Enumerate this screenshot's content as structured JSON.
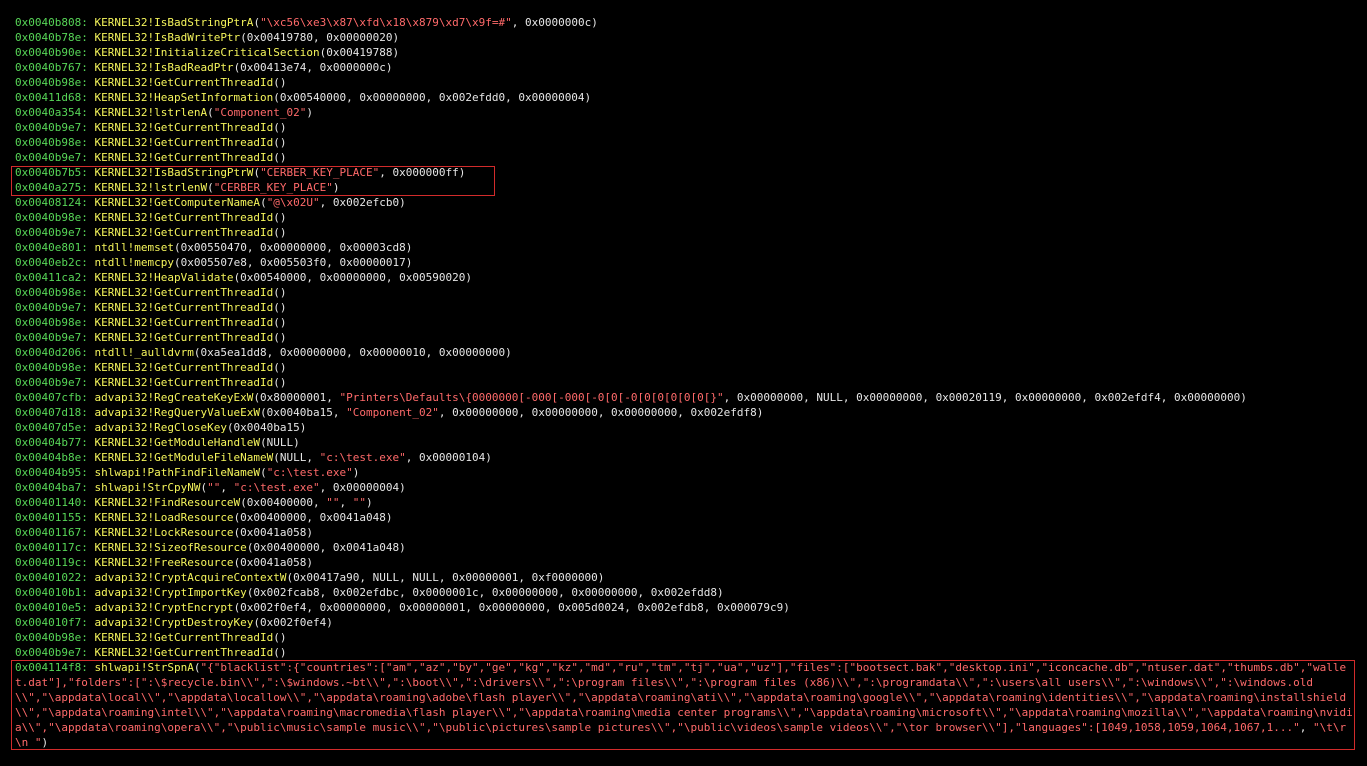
{
  "lines": [
    {
      "addr": "0x0040b808:",
      "fn": "KERNEL32!IsBadStringPtrA",
      "args": [
        [
          "p",
          "("
        ],
        [
          "s",
          "\"\\xc56\\xe3\\x87\\xfd\\x18\\x879\\xd7\\x9f=#\""
        ],
        [
          "p",
          ", 0x0000000c)"
        ]
      ]
    },
    {
      "addr": "0x0040b78e:",
      "fn": "KERNEL32!IsBadWritePtr",
      "args": [
        [
          "p",
          "(0x00419780, 0x00000020)"
        ]
      ]
    },
    {
      "addr": "0x0040b90e:",
      "fn": "KERNEL32!InitializeCriticalSection",
      "args": [
        [
          "p",
          "(0x00419788)"
        ]
      ]
    },
    {
      "addr": "0x0040b767:",
      "fn": "KERNEL32!IsBadReadPtr",
      "args": [
        [
          "p",
          "(0x00413e74, 0x0000000c)"
        ]
      ]
    },
    {
      "addr": "0x0040b98e:",
      "fn": "KERNEL32!GetCurrentThreadId",
      "args": [
        [
          "p",
          "()"
        ]
      ]
    },
    {
      "addr": "0x00411d68:",
      "fn": "KERNEL32!HeapSetInformation",
      "args": [
        [
          "p",
          "(0x00540000, 0x00000000, 0x002efdd0, 0x00000004)"
        ]
      ]
    },
    {
      "addr": "0x0040a354:",
      "fn": "KERNEL32!lstrlenA",
      "args": [
        [
          "p",
          "("
        ],
        [
          "s",
          "\"Component_02\""
        ],
        [
          "p",
          ")"
        ]
      ]
    },
    {
      "addr": "0x0040b9e7:",
      "fn": "KERNEL32!GetCurrentThreadId",
      "args": [
        [
          "p",
          "()"
        ]
      ]
    },
    {
      "addr": "0x0040b98e:",
      "fn": "KERNEL32!GetCurrentThreadId",
      "args": [
        [
          "p",
          "()"
        ]
      ]
    },
    {
      "addr": "0x0040b9e7:",
      "fn": "KERNEL32!GetCurrentThreadId",
      "args": [
        [
          "p",
          "()"
        ]
      ]
    },
    {
      "addr": "0x0040b7b5:",
      "fn": "KERNEL32!IsBadStringPtrW",
      "args": [
        [
          "p",
          "("
        ],
        [
          "s",
          "\"CERBER_KEY_PLACE\""
        ],
        [
          "p",
          ", 0x000000ff)"
        ]
      ]
    },
    {
      "addr": "0x0040a275:",
      "fn": "KERNEL32!lstrlenW",
      "args": [
        [
          "p",
          "("
        ],
        [
          "s",
          "\"CERBER_KEY_PLACE\""
        ],
        [
          "p",
          ")"
        ]
      ]
    },
    {
      "addr": "0x00408124:",
      "fn": "KERNEL32!GetComputerNameA",
      "args": [
        [
          "p",
          "("
        ],
        [
          "s",
          "\"@\\x02U\""
        ],
        [
          "p",
          ", 0x002efcb0)"
        ]
      ]
    },
    {
      "addr": "0x0040b98e:",
      "fn": "KERNEL32!GetCurrentThreadId",
      "args": [
        [
          "p",
          "()"
        ]
      ]
    },
    {
      "addr": "0x0040b9e7:",
      "fn": "KERNEL32!GetCurrentThreadId",
      "args": [
        [
          "p",
          "()"
        ]
      ]
    },
    {
      "addr": "0x0040e801:",
      "fn": "ntdll!memset",
      "args": [
        [
          "p",
          "(0x00550470, 0x00000000, 0x00003cd8)"
        ]
      ]
    },
    {
      "addr": "0x0040eb2c:",
      "fn": "ntdll!memcpy",
      "args": [
        [
          "p",
          "(0x005507e8, 0x005503f0, 0x00000017)"
        ]
      ]
    },
    {
      "addr": "0x00411ca2:",
      "fn": "KERNEL32!HeapValidate",
      "args": [
        [
          "p",
          "(0x00540000, 0x00000000, 0x00590020)"
        ]
      ]
    },
    {
      "addr": "0x0040b98e:",
      "fn": "KERNEL32!GetCurrentThreadId",
      "args": [
        [
          "p",
          "()"
        ]
      ]
    },
    {
      "addr": "0x0040b9e7:",
      "fn": "KERNEL32!GetCurrentThreadId",
      "args": [
        [
          "p",
          "()"
        ]
      ]
    },
    {
      "addr": "0x0040b98e:",
      "fn": "KERNEL32!GetCurrentThreadId",
      "args": [
        [
          "p",
          "()"
        ]
      ]
    },
    {
      "addr": "0x0040b9e7:",
      "fn": "KERNEL32!GetCurrentThreadId",
      "args": [
        [
          "p",
          "()"
        ]
      ]
    },
    {
      "addr": "0x0040d206:",
      "fn": "ntdll!_aulldvrm",
      "args": [
        [
          "p",
          "(0xa5ea1dd8, 0x00000000, 0x00000010, 0x00000000)"
        ]
      ]
    },
    {
      "addr": "0x0040b98e:",
      "fn": "KERNEL32!GetCurrentThreadId",
      "args": [
        [
          "p",
          "()"
        ]
      ]
    },
    {
      "addr": "0x0040b9e7:",
      "fn": "KERNEL32!GetCurrentThreadId",
      "args": [
        [
          "p",
          "()"
        ]
      ]
    },
    {
      "addr": "0x00407cfb:",
      "fn": "advapi32!RegCreateKeyExW",
      "args": [
        [
          "p",
          "(0x80000001, "
        ],
        [
          "s",
          "\"Printers\\Defaults\\{0000000[-000[-000[-0[0[-0[0[0[0[0[0[}\""
        ],
        [
          "p",
          ", 0x00000000, NULL, 0x00000000, 0x00020119, 0x00000000, 0x002efdf4, 0x00000000)"
        ]
      ]
    },
    {
      "addr": "0x00407d18:",
      "fn": "advapi32!RegQueryValueExW",
      "args": [
        [
          "p",
          "(0x0040ba15, "
        ],
        [
          "s",
          "\"Component_02\""
        ],
        [
          "p",
          ", 0x00000000, 0x00000000, 0x00000000, 0x002efdf8)"
        ]
      ]
    },
    {
      "addr": "0x00407d5e:",
      "fn": "advapi32!RegCloseKey",
      "args": [
        [
          "p",
          "(0x0040ba15)"
        ]
      ]
    },
    {
      "addr": "0x00404b77:",
      "fn": "KERNEL32!GetModuleHandleW",
      "args": [
        [
          "p",
          "(NULL)"
        ]
      ]
    },
    {
      "addr": "0x00404b8e:",
      "fn": "KERNEL32!GetModuleFileNameW",
      "args": [
        [
          "p",
          "(NULL, "
        ],
        [
          "s",
          "\"c:\\test.exe\""
        ],
        [
          "p",
          ", 0x00000104)"
        ]
      ]
    },
    {
      "addr": "0x00404b95:",
      "fn": "shlwapi!PathFindFileNameW",
      "args": [
        [
          "p",
          "("
        ],
        [
          "s",
          "\"c:\\test.exe\""
        ],
        [
          "p",
          ")"
        ]
      ]
    },
    {
      "addr": "0x00404ba7:",
      "fn": "shlwapi!StrCpyNW",
      "args": [
        [
          "p",
          "("
        ],
        [
          "s",
          "\"\""
        ],
        [
          "p",
          ", "
        ],
        [
          "s",
          "\"c:\\test.exe\""
        ],
        [
          "p",
          ", 0x00000004)"
        ]
      ]
    },
    {
      "addr": "0x00401140:",
      "fn": "KERNEL32!FindResourceW",
      "args": [
        [
          "p",
          "(0x00400000, "
        ],
        [
          "s",
          "\"\""
        ],
        [
          "p",
          ", "
        ],
        [
          "s",
          "\"\""
        ],
        [
          "p",
          ")"
        ]
      ]
    },
    {
      "addr": "0x00401155:",
      "fn": "KERNEL32!LoadResource",
      "args": [
        [
          "p",
          "(0x00400000, 0x0041a048)"
        ]
      ]
    },
    {
      "addr": "0x00401167:",
      "fn": "KERNEL32!LockResource",
      "args": [
        [
          "p",
          "(0x0041a058)"
        ]
      ]
    },
    {
      "addr": "0x0040117c:",
      "fn": "KERNEL32!SizeofResource",
      "args": [
        [
          "p",
          "(0x00400000, 0x0041a048)"
        ]
      ]
    },
    {
      "addr": "0x0040119c:",
      "fn": "KERNEL32!FreeResource",
      "args": [
        [
          "p",
          "(0x0041a058)"
        ]
      ]
    },
    {
      "addr": "0x00401022:",
      "fn": "advapi32!CryptAcquireContextW",
      "args": [
        [
          "p",
          "(0x00417a90, NULL, NULL, 0x00000001, 0xf0000000)"
        ]
      ]
    },
    {
      "addr": "0x004010b1:",
      "fn": "advapi32!CryptImportKey",
      "args": [
        [
          "p",
          "(0x002fcab8, 0x002efdbc, 0x0000001c, 0x00000000, 0x00000000, 0x002efdd8)"
        ]
      ]
    },
    {
      "addr": "0x004010e5:",
      "fn": "advapi32!CryptEncrypt",
      "args": [
        [
          "p",
          "(0x002f0ef4, 0x00000000, 0x00000001, 0x00000000, 0x005d0024, 0x002efdb8, 0x000079c9)"
        ]
      ]
    },
    {
      "addr": "0x004010f7:",
      "fn": "advapi32!CryptDestroyKey",
      "args": [
        [
          "p",
          "(0x002f0ef4)"
        ]
      ]
    },
    {
      "addr": "0x0040b98e:",
      "fn": "KERNEL32!GetCurrentThreadId",
      "args": [
        [
          "p",
          "()"
        ]
      ]
    },
    {
      "addr": "0x0040b9e7:",
      "fn": "KERNEL32!GetCurrentThreadId",
      "args": [
        [
          "p",
          "()"
        ]
      ]
    }
  ],
  "last_line": {
    "addr": "0x004114f8:",
    "fn": "shlwapi!StrSpnA",
    "open": "(",
    "str1": "\"{\"blacklist\":{\"countries\":[\"am\",\"az\",\"by\",\"ge\",\"kg\",\"kz\",\"md\",\"ru\",\"tm\",\"tj\",\"ua\",\"uz\"],\"files\":[\"bootsect.bak\",\"desktop.ini\",\"iconcache.db\",\"ntuser.dat\",\"thumbs.db\",\"wallet.dat\"],\"folders\":[\":\\$recycle.bin\\\\\",\":\\$windows.~bt\\\\\",\":\\boot\\\\\",\":\\drivers\\\\\",\":\\program files\\\\\",\":\\program files (x86)\\\\\",\":\\programdata\\\\\",\":\\users\\all users\\\\\",\":\\windows\\\\\",\":\\windows.old\\\\\",\"\\appdata\\local\\\\\",\"\\appdata\\locallow\\\\\",\"\\appdata\\roaming\\adobe\\flash player\\\\\",\"\\appdata\\roaming\\ati\\\\\",\"\\appdata\\roaming\\google\\\\\",\"\\appdata\\roaming\\identities\\\\\",\"\\appdata\\roaming\\installshield\\\\\",\"\\appdata\\roaming\\intel\\\\\",\"\\appdata\\roaming\\macromedia\\flash player\\\\\",\"\\appdata\\roaming\\media center programs\\\\\",\"\\appdata\\roaming\\microsoft\\\\\",\"\\appdata\\roaming\\mozilla\\\\\",\"\\appdata\\roaming\\nvidia\\\\\",\"\\appdata\\roaming\\opera\\\\\",\"\\public\\music\\sample music\\\\\",\"\\public\\pictures\\sample pictures\\\\\",\"\\public\\videos\\sample videos\\\\\",\"\\tor browser\\\\\"],\"languages\":[1049,1058,1059,1064,1067,1...\"",
    "sep": ", ",
    "str2": "\"\\t\\r\\n \"",
    "close": ")"
  },
  "colors": {
    "background": "#000000",
    "address": "#57d657",
    "function": "#f5f55b",
    "string": "#ff6a6a",
    "plain": "#e6e6e6",
    "highlight_box": "#d22b2b"
  }
}
